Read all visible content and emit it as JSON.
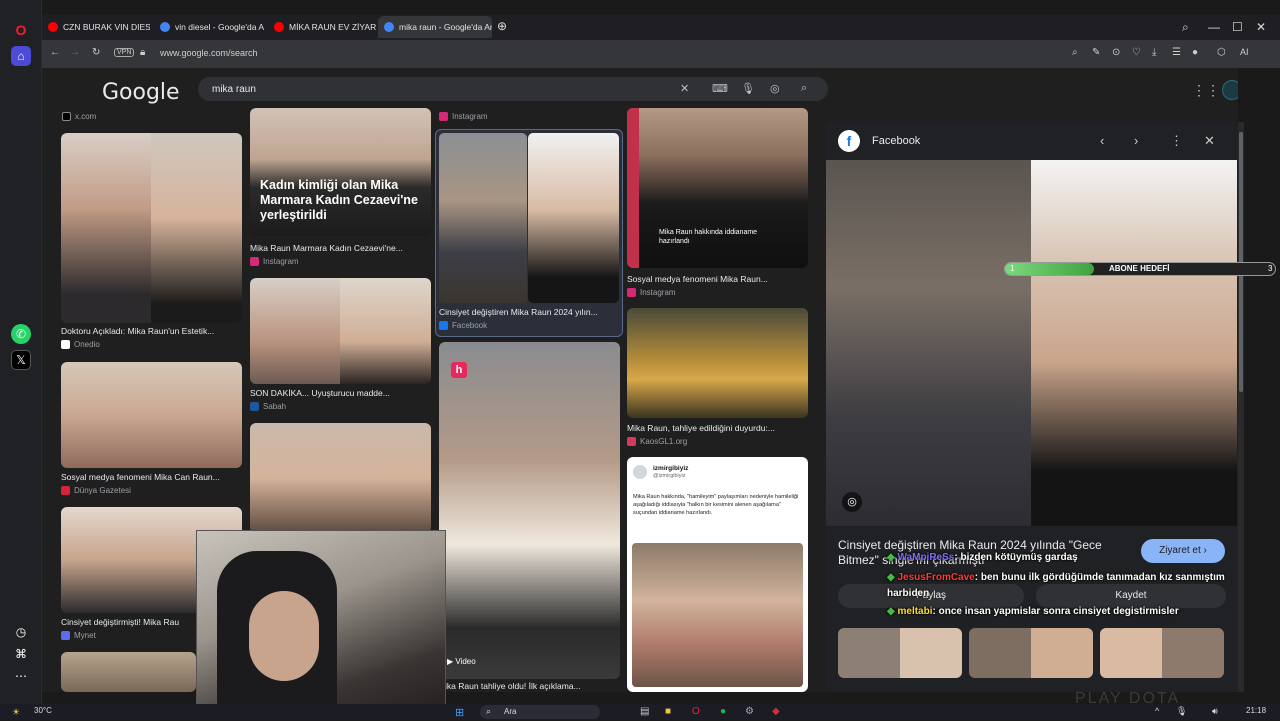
{
  "tabs": [
    {
      "title": "CZN BURAK VIN DIESEL F",
      "fav": "#ff0000"
    },
    {
      "title": "vin diesel - Google'da Ara",
      "fav": "#4285f4"
    },
    {
      "title": "MİKA RAUN EV ZİYARETİ",
      "fav": "#ff0000"
    },
    {
      "title": "mika raun - Google'da Ara",
      "fav": "#4285f4"
    }
  ],
  "address": {
    "vpn": "VPN",
    "url": "www.google.com/search",
    "ai": "AI"
  },
  "google": {
    "logo": "Google",
    "query": "mika raun"
  },
  "results": {
    "c1_top_source": "x.com",
    "c1_r1_caption": "Doktoru Açıkladı: Mika Raun'un Estetik...",
    "c1_r1_source": "Onedio",
    "c1_r2_caption": "Sosyal medya fenomeni Mika Can Raun...",
    "c1_r2_source": "Dünya Gazetesi",
    "c1_r3_caption": "Cinsiyet değiştirmişti! Mika Rau",
    "c1_r3_source": "Mynet",
    "c2_overlay": "Kadın kimliği olan Mika Marmara Kadın Cezaevi'ne yerleştirildi",
    "c2_r1_caption": "Mika Raun Marmara Kadın Cezaevi'ne...",
    "c2_r1_source": "Instagram",
    "c2_r2_caption": "SON DAKİKA... Uyuşturucu madde...",
    "c2_r2_source": "Sabah",
    "c3_top_source": "Instagram",
    "c3_r1_caption": "Cinsiyet değiştiren Mika Raun 2024 yılın...",
    "c3_r1_source": "Facebook",
    "c3_video": "Video",
    "c3_r2_caption": "ika Raun tahliye oldu! İlk açıklama...",
    "c4_overlay": "Mika Raun hakkında iddianame hazırlandı",
    "c4_r1_caption": "Sosyal medya fenomeni Mika Raun...",
    "c4_r1_source": "Instagram",
    "c4_r2_caption": "Mika Raun, tahliye edildiğini duyurdu:...",
    "c4_r2_source": "KaosGL1.org",
    "c4_tweet_user": "izmirgibiyiz",
    "c4_tweet_handle": "@izmirgibiyiz",
    "c4_tweet_text": "Mika Raun hakkında, \"hamileyim\" paylaşımları nedeniyle hamileliği aşağıladığı iddiasıyla \"halkın bir kesimini alenen aşağılama\" suçundan iddianame hazırlandı."
  },
  "panel": {
    "source": "Facebook",
    "title": "Cinsiyet değiştiren Mika Raun 2024 yılında \"Gece Bitmez\" single'ını çıkarmıştı",
    "visit_label": "Ziyaret et",
    "share_label": "Paylaş",
    "save_label": "Kaydet"
  },
  "goal": {
    "start": "1",
    "label": "ABONE HEDEFİ",
    "end": "3",
    "progress": 0.33
  },
  "chat": [
    {
      "user": "WaMpiReSs",
      "user_color": "#7b6cff",
      "text": ": bizden kötüymüş gardaş"
    },
    {
      "user": "JesusFromCave",
      "user_color": "#ff3b3b",
      "text": ": ben bunu ilk gördüğümde tanımadan kız sanmıştım"
    },
    {
      "user": "",
      "user_color": "#ffffff",
      "text": "harbiden"
    },
    {
      "user": "meltabi",
      "user_color": "#ffdd33",
      "text": ": once insan yapmislar sonra cinsiyet degistirmisler"
    }
  ],
  "taskbar": {
    "temp": "30°C",
    "search": "Ara",
    "time": "21:18"
  },
  "watermark": "PLAY DOTA",
  "icons": [
    "opera-icon",
    "home-icon",
    "whatsapp-icon",
    "x-icon",
    "clock-icon",
    "gift-icon",
    "more-icon",
    "back-icon",
    "forward-icon",
    "reload-icon",
    "lock-icon",
    "clear-icon",
    "keyboard-icon",
    "mic-icon",
    "lens-icon",
    "search-icon",
    "apps-icon",
    "facebook-icon",
    "prev-icon",
    "next-icon",
    "kebab-icon",
    "close-icon",
    "windows-icon"
  ]
}
